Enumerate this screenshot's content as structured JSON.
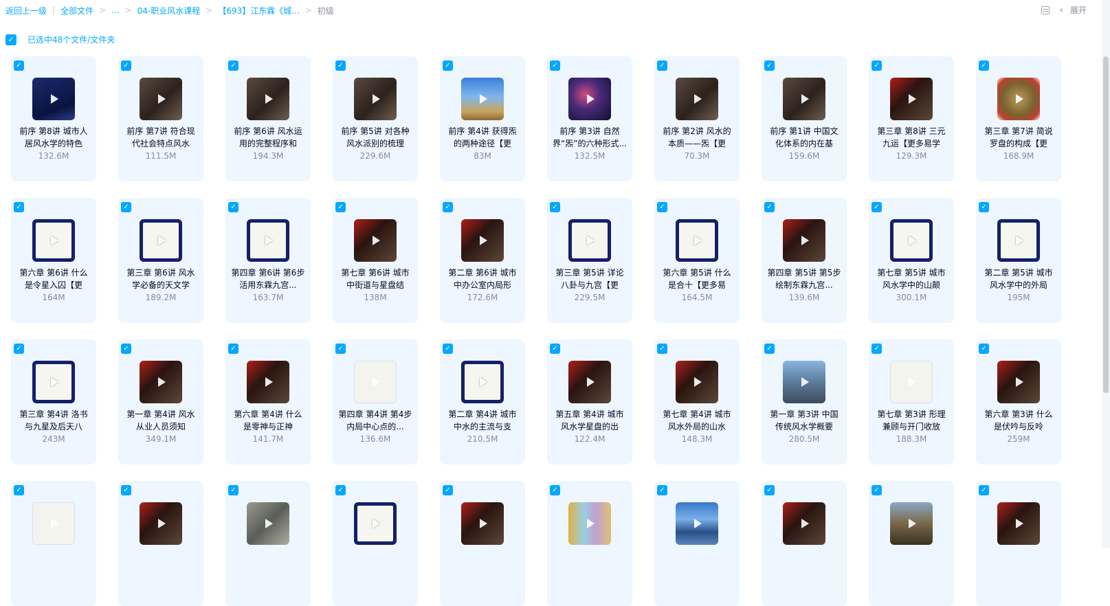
{
  "breadcrumb": {
    "back": "返回上一级",
    "all_files": "全部文件",
    "ellipsis": "...",
    "course": "04-职业风水课程",
    "folder": "【693】江东霖《城...",
    "current": "初级"
  },
  "toolbar": {
    "expand_label": "展开",
    "list_view_icon": "list-view-icon",
    "chevron_icon": "chevron-left-icon"
  },
  "selection": {
    "checked": "✓",
    "summary": "已选中48个文件/文件夹"
  },
  "colors": {
    "accent": "#06a7ff",
    "card_bg": "#eef6ff",
    "muted": "#878c9c"
  },
  "files": [
    {
      "name": "前序 第8讲 城市人居风水学的特色",
      "size": "132.6M",
      "thumb": "t-blue"
    },
    {
      "name": "前序 第7讲 符合现代社会特点风水",
      "size": "111.5M",
      "thumb": "t-dark"
    },
    {
      "name": "前序 第6讲 风水运用的完整程序和",
      "size": "194.3M",
      "thumb": "t-dark"
    },
    {
      "name": "前序 第5讲 对各种风水派别的梳理",
      "size": "229.6M",
      "thumb": "t-dark"
    },
    {
      "name": "前序 第4讲 获得炁的两种途径【更",
      "size": "83M",
      "thumb": "t-sky"
    },
    {
      "name": "前序 第3讲 自然界“炁”的六种形式...",
      "size": "132.5M",
      "thumb": "t-space"
    },
    {
      "name": "前序 第2讲 风水的本质——炁【更",
      "size": "70.3M",
      "thumb": "t-dark"
    },
    {
      "name": "前序 第1讲 中国文化体系的内在基",
      "size": "159.6M",
      "thumb": "t-dark"
    },
    {
      "name": "第三章 第8讲 三元九运【更多易学",
      "size": "129.3M",
      "thumb": "t-cinema"
    },
    {
      "name": "第三章 第7讲 简说罗盘的构成【更",
      "size": "168.9M",
      "thumb": "t-compass"
    },
    {
      "name": "第六章 第6讲 什么是令星入囚【更",
      "size": "164M",
      "thumb": "t-chart"
    },
    {
      "name": "第三章 第6讲 风水学必备的天文学",
      "size": "189.2M",
      "thumb": "t-chart"
    },
    {
      "name": "第四章 第6讲 第6步 活用东霖九宫...",
      "size": "163.7M",
      "thumb": "t-chart"
    },
    {
      "name": "第七章 第6讲 城市中街道与星盘结",
      "size": "138M",
      "thumb": "t-cinema"
    },
    {
      "name": "第二章 第6讲 城市中办公室内局形",
      "size": "172.6M",
      "thumb": "t-cinema"
    },
    {
      "name": "第三章 第5讲 详论八卦与九宫【更",
      "size": "229.5M",
      "thumb": "t-chart"
    },
    {
      "name": "第六章 第5讲 什么是合十【更多易",
      "size": "164.5M",
      "thumb": "t-chart"
    },
    {
      "name": "第四章 第5讲 第5步 绘制东霖九宫...",
      "size": "139.6M",
      "thumb": "t-cinema"
    },
    {
      "name": "第七章 第5讲 城市风水学中的山颠",
      "size": "300.1M",
      "thumb": "t-chart"
    },
    {
      "name": "第二章 第5讲 城市风水学中的外局",
      "size": "195M",
      "thumb": "t-chart"
    },
    {
      "name": "第三章 第4讲 洛书与九星及后天八",
      "size": "243M",
      "thumb": "t-chart"
    },
    {
      "name": "第一章 第4讲 风水从业人员须知",
      "size": "349.1M",
      "thumb": "t-cinema"
    },
    {
      "name": "第六章 第4讲 什么是零神与正神",
      "size": "141.7M",
      "thumb": "t-cinema"
    },
    {
      "name": "第四章 第4讲 第4步 内局中心点的...",
      "size": "136.6M",
      "thumb": "t-paper"
    },
    {
      "name": "第二章 第4讲 城市中水的主流与支",
      "size": "210.5M",
      "thumb": "t-chart"
    },
    {
      "name": "第五章 第4讲 城市风水学星盘的出",
      "size": "122.4M",
      "thumb": "t-cinema"
    },
    {
      "name": "第七章 第4讲 城市风水外局的山水",
      "size": "148.3M",
      "thumb": "t-cinema"
    },
    {
      "name": "第一章 第3讲 中国传统风水学概要",
      "size": "280.5M",
      "thumb": "t-city"
    },
    {
      "name": "第七章 第3讲 形理兼顾与开门收放",
      "size": "188.3M",
      "thumb": "t-paper"
    },
    {
      "name": "第六章 第3讲 什么是伏吟与反呤",
      "size": "259M",
      "thumb": "t-cinema"
    },
    {
      "name": "",
      "size": "",
      "thumb": "t-paper"
    },
    {
      "name": "",
      "size": "",
      "thumb": "t-cinema"
    },
    {
      "name": "",
      "size": "",
      "thumb": "t-aerial"
    },
    {
      "name": "",
      "size": "",
      "thumb": "t-chart"
    },
    {
      "name": "",
      "size": "",
      "thumb": "t-cinema"
    },
    {
      "name": "",
      "size": "",
      "thumb": "t-colored"
    },
    {
      "name": "",
      "size": "",
      "thumb": "t-lake"
    },
    {
      "name": "",
      "size": "",
      "thumb": "t-cinema"
    },
    {
      "name": "",
      "size": "",
      "thumb": "t-statue"
    },
    {
      "name": "",
      "size": "",
      "thumb": "t-cinema"
    }
  ]
}
